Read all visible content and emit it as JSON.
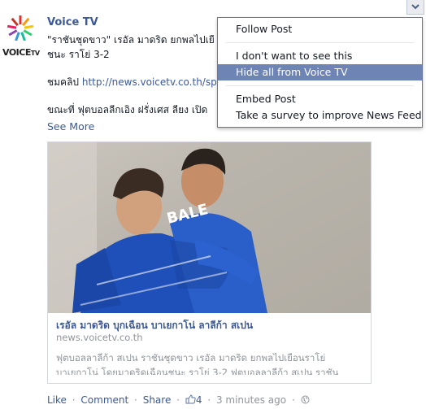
{
  "post": {
    "author": "Voice TV",
    "logo_text": "VOICE",
    "logo_text_small": "TV",
    "lines": [
      "\"ราชันชุดขาว\" เรอัล มาดริด ยกพลไปเยื",
      "ชนะ ราโย่ 3-2",
      "ชมคลิป ",
      "ขณะที่ ฟุตบอลลีกเอิง ฝรั่งเศส ลียง เปิด"
    ],
    "link": "http://news.voicetv.co.th/spo",
    "see_more": "See More"
  },
  "card": {
    "jersey_text": "BALE",
    "title": "เรอัล มาดริด บุกเฉือน บาเยกาโน่ ลาลีก้า สเปน",
    "domain": "news.voicetv.co.th",
    "desc_line1": "ฟุตบอลลาลีก้า สเปน ราชันชุดขาว เรอัล มาดริด ยกพลไปเยือนราโย่",
    "desc_line2": "บาเยกาโน่ โดยมาดริดเฉือนชนะ ราโย่ 3-2 ฟุตบอลลาลีก้า สเปน ราชัน"
  },
  "actions": {
    "like": "Like",
    "comment": "Comment",
    "share": "Share",
    "like_count": "4",
    "time": "3 minutes ago",
    "dot": "·"
  },
  "menu": {
    "items": [
      "Follow Post",
      "I don't want to see this",
      "Hide all from Voice TV",
      "Embed Post",
      "Take a survey to improve News Feed"
    ],
    "active_index": 2,
    "highlight_color": "#6d84b4"
  },
  "colors": {
    "link": "#3b5998",
    "muted": "#90949c"
  }
}
